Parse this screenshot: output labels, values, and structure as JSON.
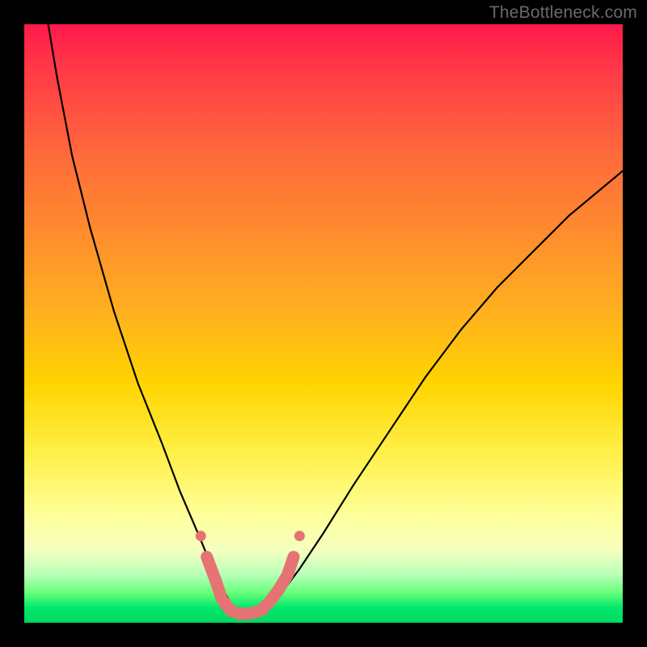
{
  "watermark": "TheBottleneck.com",
  "chart_data": {
    "type": "line",
    "title": "",
    "xlabel": "",
    "ylabel": "",
    "xlim": [
      0,
      100
    ],
    "ylim": [
      0,
      100
    ],
    "gradient_stops": [
      {
        "pct": 0,
        "color": "#ff1a4a"
      },
      {
        "pct": 8,
        "color": "#ff3b47"
      },
      {
        "pct": 22,
        "color": "#ff6b3b"
      },
      {
        "pct": 34,
        "color": "#ff8a2e"
      },
      {
        "pct": 48,
        "color": "#ffb01f"
      },
      {
        "pct": 60,
        "color": "#ffd400"
      },
      {
        "pct": 72,
        "color": "#fff04a"
      },
      {
        "pct": 82,
        "color": "#ffff9a"
      },
      {
        "pct": 88,
        "color": "#f4ffc0"
      },
      {
        "pct": 92,
        "color": "#b8ffb8"
      },
      {
        "pct": 95,
        "color": "#68ff7a"
      },
      {
        "pct": 97.5,
        "color": "#00e86c"
      },
      {
        "pct": 100,
        "color": "#00d860"
      }
    ],
    "series": [
      {
        "name": "bottleneck-curve",
        "x": [
          4,
          5.5,
          8,
          11,
          15,
          19,
          23,
          26,
          29,
          31.5,
          33.5,
          35,
          36.5,
          38,
          40.5,
          43,
          46,
          50,
          55,
          61,
          67,
          73,
          79,
          85,
          91,
          97,
          100
        ],
        "y": [
          100,
          91,
          78,
          66,
          52,
          40,
          30,
          22,
          15,
          9,
          5,
          2.5,
          1.5,
          1.5,
          2.5,
          5,
          9,
          15,
          23,
          32,
          41,
          49,
          56,
          62,
          68,
          73,
          75.5
        ]
      }
    ],
    "marker_band": {
      "name": "marker-cluster",
      "color": "#e57373",
      "points": [
        {
          "x": 30.5,
          "y": 11
        },
        {
          "x": 32,
          "y": 7
        },
        {
          "x": 33,
          "y": 4
        },
        {
          "x": 34.5,
          "y": 2
        },
        {
          "x": 36,
          "y": 1.5
        },
        {
          "x": 37.5,
          "y": 1.5
        },
        {
          "x": 39.5,
          "y": 2
        },
        {
          "x": 41,
          "y": 3.5
        },
        {
          "x": 42.5,
          "y": 5.5
        },
        {
          "x": 44,
          "y": 8
        },
        {
          "x": 45,
          "y": 11
        }
      ]
    }
  }
}
